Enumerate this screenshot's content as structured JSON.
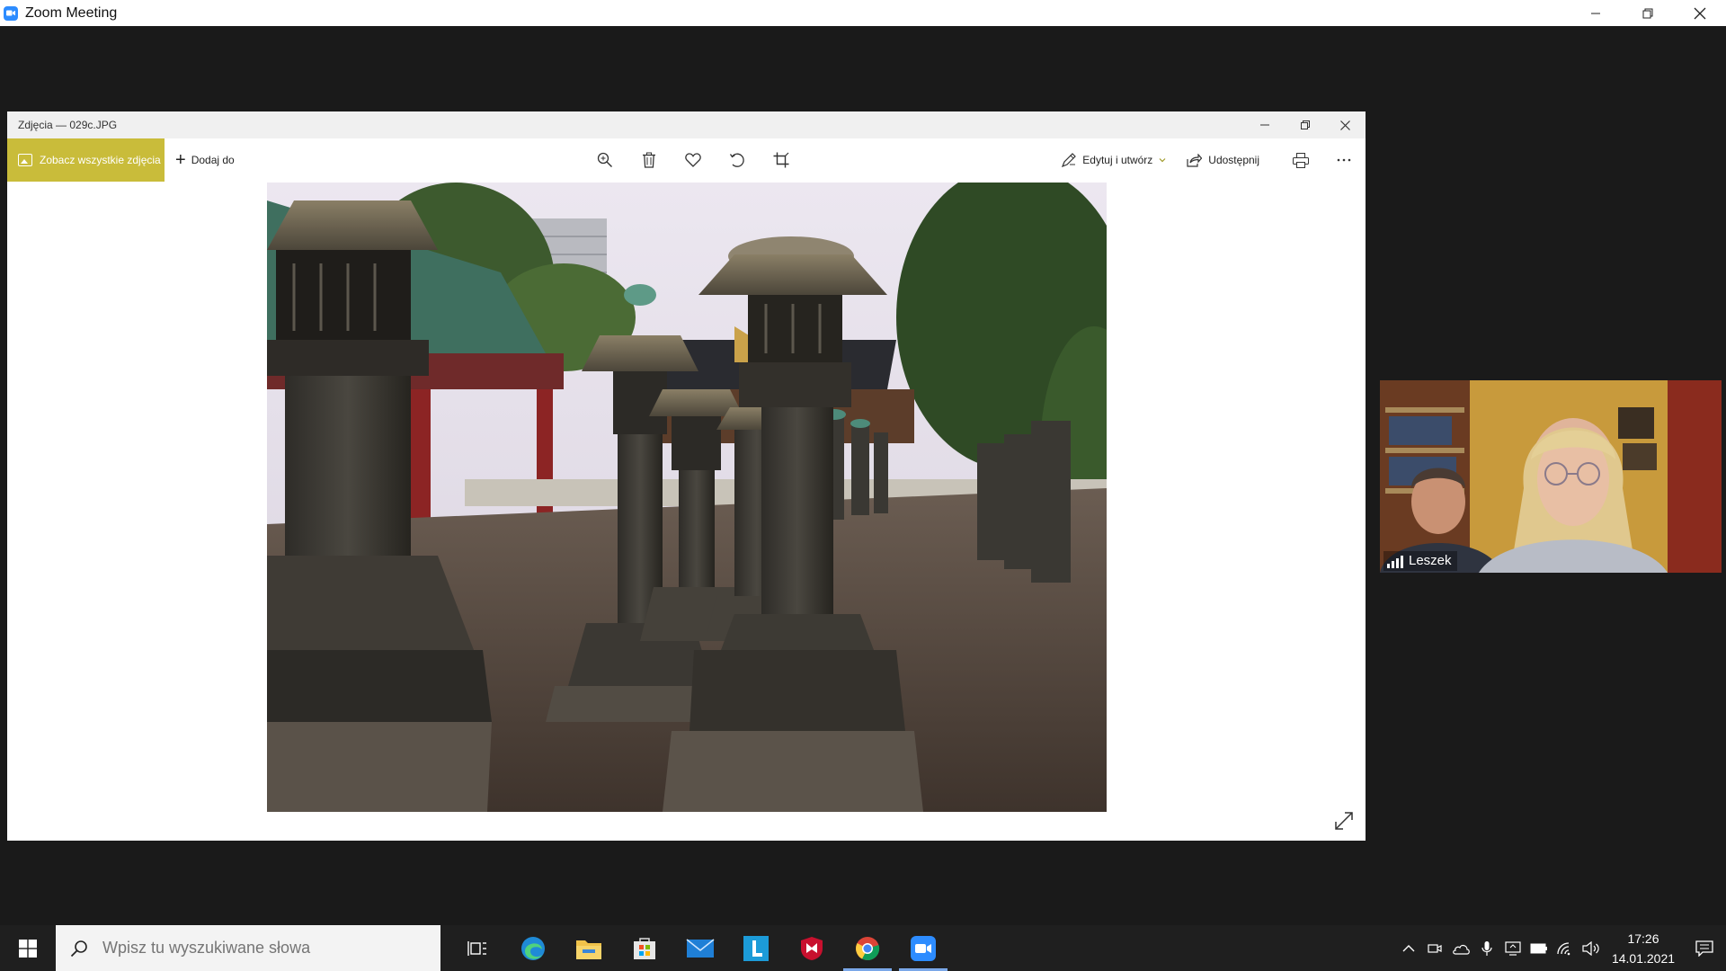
{
  "zoom": {
    "title": "Zoom Meeting",
    "controls": [
      "minimize-icon",
      "restore-icon",
      "close-icon"
    ]
  },
  "photos": {
    "title": "Zdjęcia — 029c.JPG",
    "see_all_label": "Zobacz wszystkie zdjęcia",
    "add_to_label": "Dodaj do",
    "edit_label": "Edytuj i utwórz",
    "share_label": "Udostępnij",
    "accent_color": "#c9bc3a",
    "center_tools": [
      "zoom-in-icon",
      "delete-icon",
      "favorite-icon",
      "rotate-icon",
      "crop-icon"
    ]
  },
  "participant": {
    "name": "Leszek"
  },
  "taskbar": {
    "search_placeholder": "Wpisz tu wyszukiwane słowa",
    "time": "17:26",
    "date": "14.01.2021"
  }
}
